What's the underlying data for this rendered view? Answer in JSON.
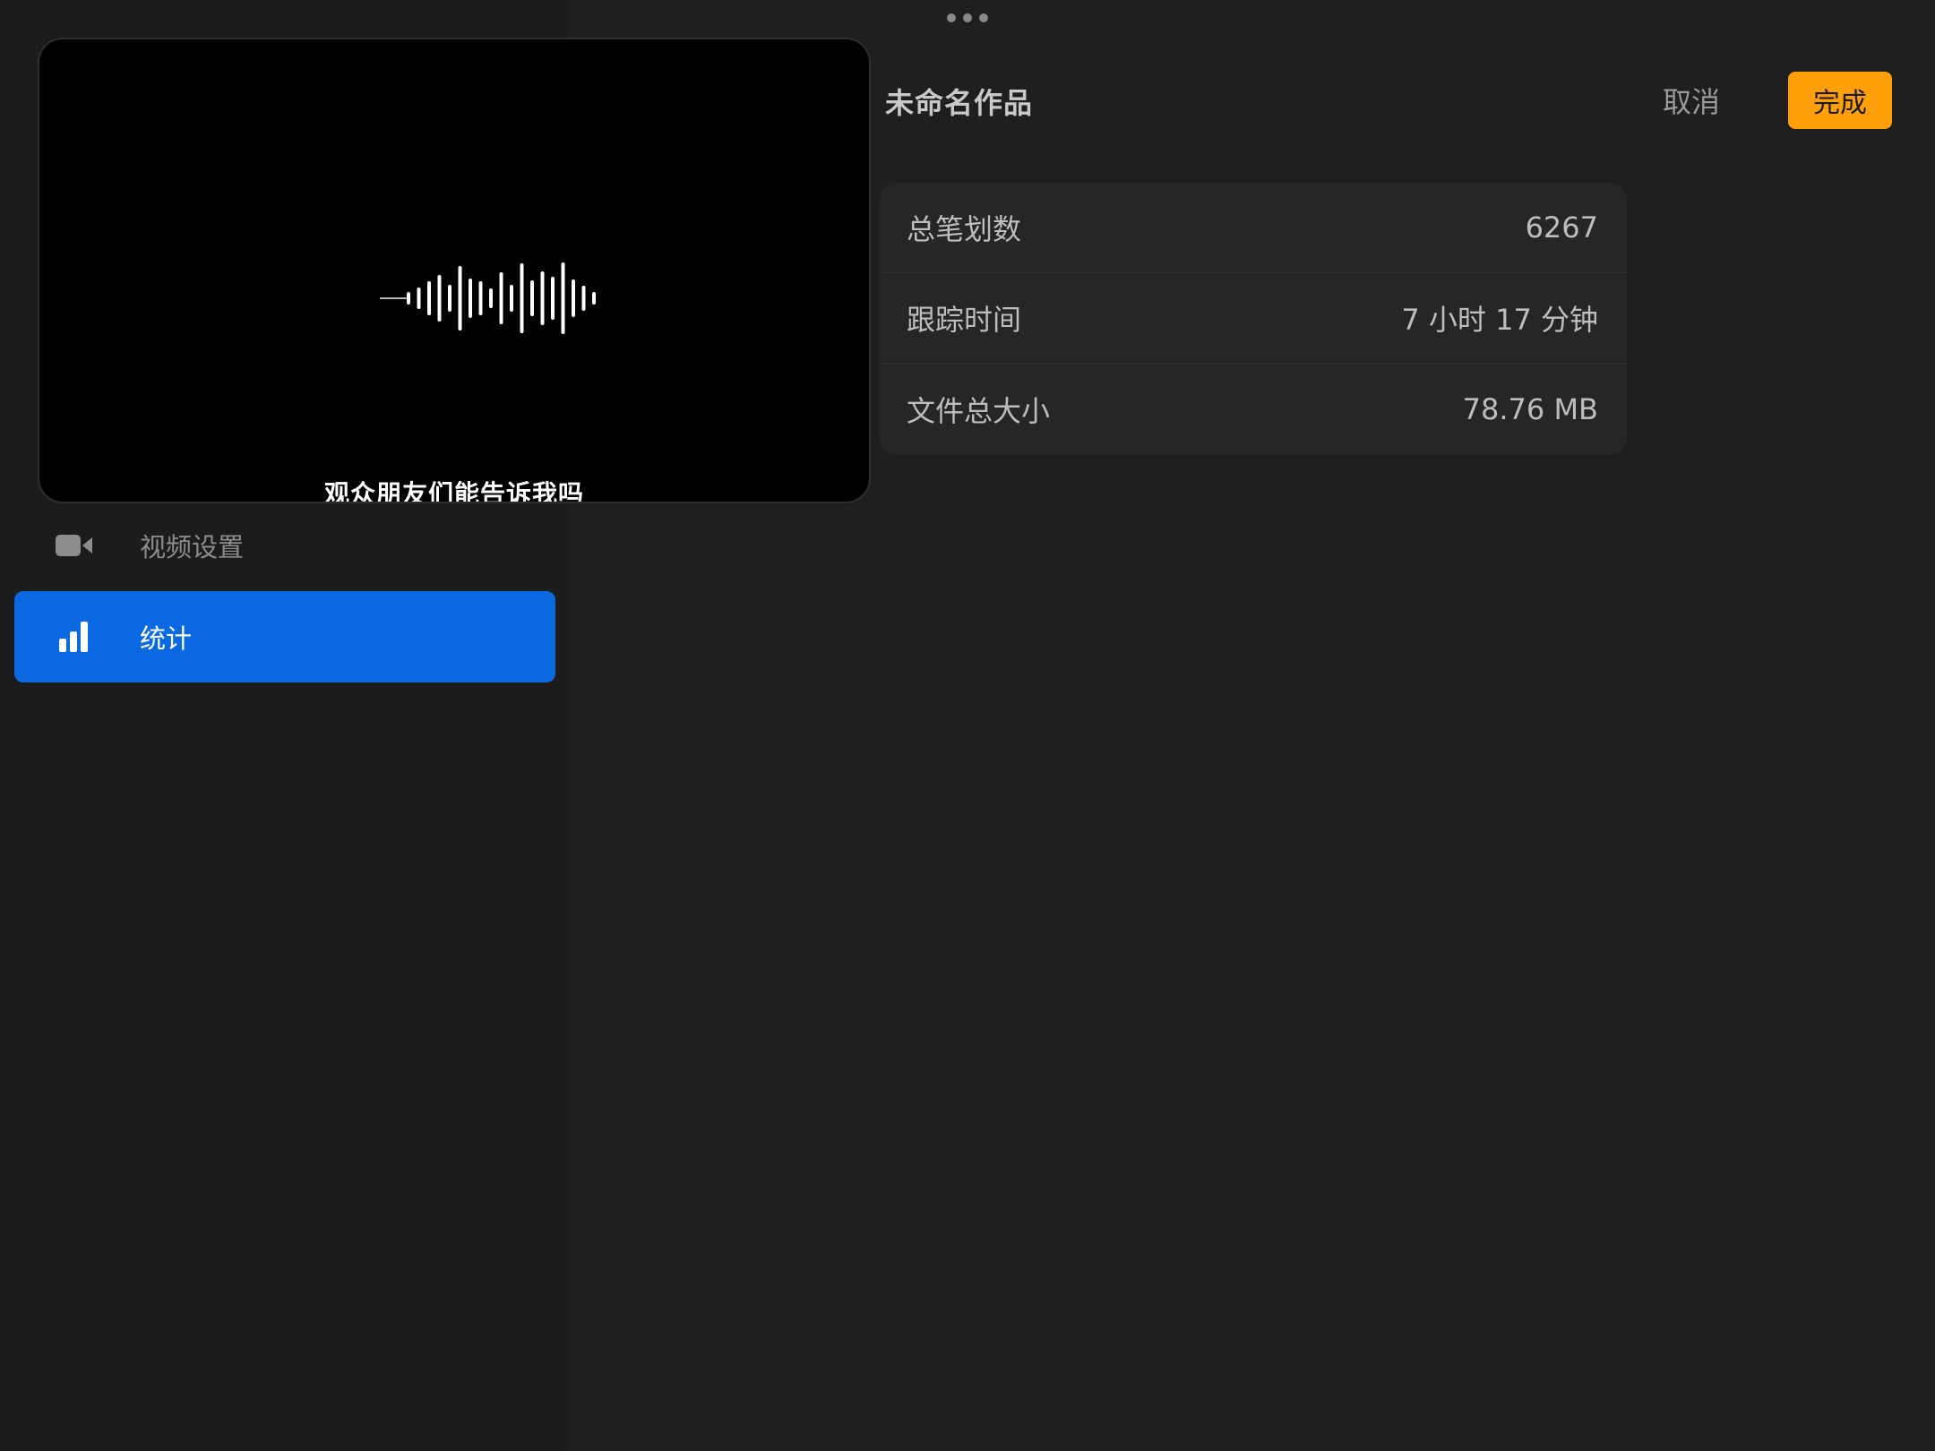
{
  "header": {
    "title": "未命名作品",
    "cancel_label": "取消",
    "done_label": "完成"
  },
  "pip": {
    "subtitle": "观众朋友们能告诉我吗"
  },
  "sidebar": {
    "items": [
      {
        "label": "视频设置",
        "icon": "video-camera-icon",
        "selected": false
      },
      {
        "label": "统计",
        "icon": "bar-chart-icon",
        "selected": true
      }
    ]
  },
  "stats": {
    "rows": [
      {
        "label": "总笔划数",
        "value": "6267"
      },
      {
        "label": "跟踪时间",
        "value": "7 小时 17 分钟"
      },
      {
        "label": "文件总大小",
        "value": "78.76 MB"
      }
    ]
  },
  "colors": {
    "accent": "#ff9f0a",
    "selection": "#0a69e0",
    "background": "#1d1d1d"
  }
}
